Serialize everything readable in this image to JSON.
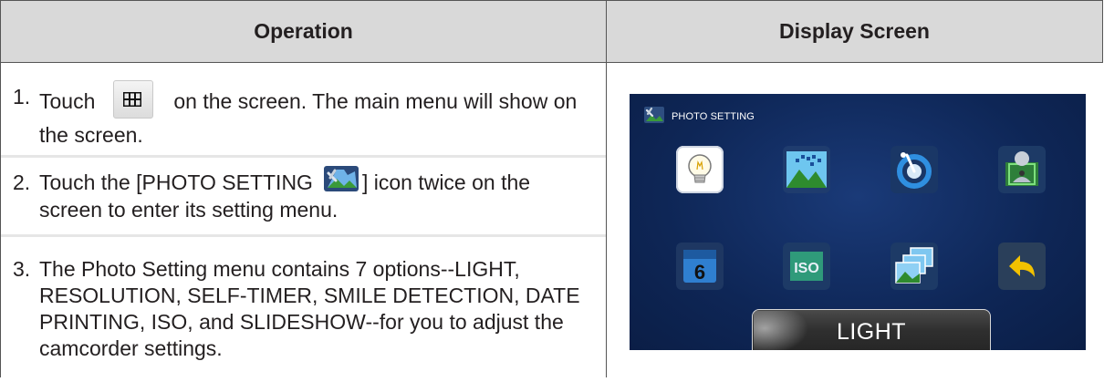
{
  "table": {
    "header_operation": "Operation",
    "header_display": "Display Screen"
  },
  "steps": [
    {
      "num": "1.",
      "before": "Touch",
      "icon": "grid-menu-icon",
      "after": "on the screen. The main menu will show on the screen."
    },
    {
      "num": "2.",
      "before": "Touch the [PHOTO SETTING",
      "icon": "photo-setting-icon",
      "after": "] icon twice on the screen to enter its setting menu."
    },
    {
      "num": "3.",
      "text": "The Photo Setting menu contains 7 options--LIGHT, RESOLUTION, SELF-TIMER, SMILE DETECTION, DATE PRINTING, ISO, and SLIDESHOW--for you to adjust the camcorder settings."
    }
  ],
  "screen": {
    "title": "PHOTO SETTING",
    "selected_label": "LIGHT",
    "menu_icons": [
      "light-bulb-icon",
      "resolution-icon",
      "self-timer-icon",
      "smile-detection-icon",
      "date-printing-icon",
      "iso-icon",
      "slideshow-icon",
      "return-icon"
    ],
    "background_color": "#0e2656"
  }
}
